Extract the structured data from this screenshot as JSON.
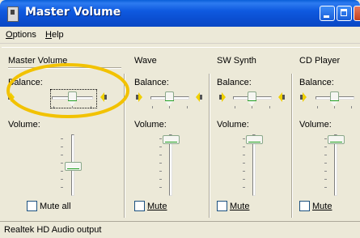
{
  "window": {
    "title": "Master Volume",
    "title_icon": "speaker-app-icon"
  },
  "menu": {
    "options": "Options",
    "help": "Help"
  },
  "channels": [
    {
      "title": "Master Volume",
      "balance_label": "Balance:",
      "volume_label": "Volume:",
      "mute_label": "Mute all",
      "balance": 0.5,
      "volume": 0.35,
      "mute_checked": false
    },
    {
      "title": "Wave",
      "balance_label": "Balance:",
      "volume_label": "Volume:",
      "mute_label": "Mute",
      "balance": 0.5,
      "volume": 1.0,
      "mute_checked": false
    },
    {
      "title": "SW Synth",
      "balance_label": "Balance:",
      "volume_label": "Volume:",
      "mute_label": "Mute",
      "balance": 0.5,
      "volume": 1.0,
      "mute_checked": false
    },
    {
      "title": "CD Player",
      "balance_label": "Balance:",
      "volume_label": "Volume:",
      "mute_label": "Mute",
      "balance": 0.5,
      "volume": 1.0,
      "mute_checked": false
    }
  ],
  "status": {
    "text": "Realtek HD Audio output"
  },
  "colors": {
    "highlight_ring": "#f2c200",
    "title_bar": "#0a5fd8"
  }
}
